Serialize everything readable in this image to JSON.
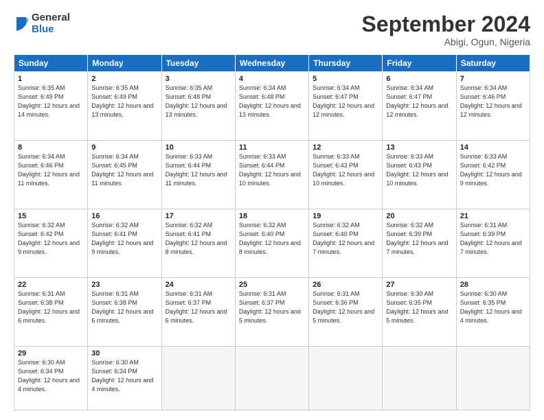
{
  "logo": {
    "general": "General",
    "blue": "Blue"
  },
  "header": {
    "month": "September 2024",
    "location": "Abigi, Ogun, Nigeria"
  },
  "weekdays": [
    "Sunday",
    "Monday",
    "Tuesday",
    "Wednesday",
    "Thursday",
    "Friday",
    "Saturday"
  ],
  "weeks": [
    [
      {
        "day": "1",
        "sunrise": "Sunrise: 6:35 AM",
        "sunset": "Sunset: 6:49 PM",
        "daylight": "Daylight: 12 hours and 14 minutes."
      },
      {
        "day": "2",
        "sunrise": "Sunrise: 6:35 AM",
        "sunset": "Sunset: 6:49 PM",
        "daylight": "Daylight: 12 hours and 13 minutes."
      },
      {
        "day": "3",
        "sunrise": "Sunrise: 6:35 AM",
        "sunset": "Sunset: 6:48 PM",
        "daylight": "Daylight: 12 hours and 13 minutes."
      },
      {
        "day": "4",
        "sunrise": "Sunrise: 6:34 AM",
        "sunset": "Sunset: 6:48 PM",
        "daylight": "Daylight: 12 hours and 13 minutes."
      },
      {
        "day": "5",
        "sunrise": "Sunrise: 6:34 AM",
        "sunset": "Sunset: 6:47 PM",
        "daylight": "Daylight: 12 hours and 12 minutes."
      },
      {
        "day": "6",
        "sunrise": "Sunrise: 6:34 AM",
        "sunset": "Sunset: 6:47 PM",
        "daylight": "Daylight: 12 hours and 12 minutes."
      },
      {
        "day": "7",
        "sunrise": "Sunrise: 6:34 AM",
        "sunset": "Sunset: 6:46 PM",
        "daylight": "Daylight: 12 hours and 12 minutes."
      }
    ],
    [
      {
        "day": "8",
        "sunrise": "Sunrise: 6:34 AM",
        "sunset": "Sunset: 6:46 PM",
        "daylight": "Daylight: 12 hours and 11 minutes."
      },
      {
        "day": "9",
        "sunrise": "Sunrise: 6:34 AM",
        "sunset": "Sunset: 6:45 PM",
        "daylight": "Daylight: 12 hours and 11 minutes."
      },
      {
        "day": "10",
        "sunrise": "Sunrise: 6:33 AM",
        "sunset": "Sunset: 6:44 PM",
        "daylight": "Daylight: 12 hours and 11 minutes."
      },
      {
        "day": "11",
        "sunrise": "Sunrise: 6:33 AM",
        "sunset": "Sunset: 6:44 PM",
        "daylight": "Daylight: 12 hours and 10 minutes."
      },
      {
        "day": "12",
        "sunrise": "Sunrise: 6:33 AM",
        "sunset": "Sunset: 6:43 PM",
        "daylight": "Daylight: 12 hours and 10 minutes."
      },
      {
        "day": "13",
        "sunrise": "Sunrise: 6:33 AM",
        "sunset": "Sunset: 6:43 PM",
        "daylight": "Daylight: 12 hours and 10 minutes."
      },
      {
        "day": "14",
        "sunrise": "Sunrise: 6:33 AM",
        "sunset": "Sunset: 6:42 PM",
        "daylight": "Daylight: 12 hours and 9 minutes."
      }
    ],
    [
      {
        "day": "15",
        "sunrise": "Sunrise: 6:32 AM",
        "sunset": "Sunset: 6:42 PM",
        "daylight": "Daylight: 12 hours and 9 minutes."
      },
      {
        "day": "16",
        "sunrise": "Sunrise: 6:32 AM",
        "sunset": "Sunset: 6:41 PM",
        "daylight": "Daylight: 12 hours and 9 minutes."
      },
      {
        "day": "17",
        "sunrise": "Sunrise: 6:32 AM",
        "sunset": "Sunset: 6:41 PM",
        "daylight": "Daylight: 12 hours and 8 minutes."
      },
      {
        "day": "18",
        "sunrise": "Sunrise: 6:32 AM",
        "sunset": "Sunset: 6:40 PM",
        "daylight": "Daylight: 12 hours and 8 minutes."
      },
      {
        "day": "19",
        "sunrise": "Sunrise: 6:32 AM",
        "sunset": "Sunset: 6:40 PM",
        "daylight": "Daylight: 12 hours and 7 minutes."
      },
      {
        "day": "20",
        "sunrise": "Sunrise: 6:32 AM",
        "sunset": "Sunset: 6:39 PM",
        "daylight": "Daylight: 12 hours and 7 minutes."
      },
      {
        "day": "21",
        "sunrise": "Sunrise: 6:31 AM",
        "sunset": "Sunset: 6:39 PM",
        "daylight": "Daylight: 12 hours and 7 minutes."
      }
    ],
    [
      {
        "day": "22",
        "sunrise": "Sunrise: 6:31 AM",
        "sunset": "Sunset: 6:38 PM",
        "daylight": "Daylight: 12 hours and 6 minutes."
      },
      {
        "day": "23",
        "sunrise": "Sunrise: 6:31 AM",
        "sunset": "Sunset: 6:38 PM",
        "daylight": "Daylight: 12 hours and 6 minutes."
      },
      {
        "day": "24",
        "sunrise": "Sunrise: 6:31 AM",
        "sunset": "Sunset: 6:37 PM",
        "daylight": "Daylight: 12 hours and 6 minutes."
      },
      {
        "day": "25",
        "sunrise": "Sunrise: 6:31 AM",
        "sunset": "Sunset: 6:37 PM",
        "daylight": "Daylight: 12 hours and 5 minutes."
      },
      {
        "day": "26",
        "sunrise": "Sunrise: 6:31 AM",
        "sunset": "Sunset: 6:36 PM",
        "daylight": "Daylight: 12 hours and 5 minutes."
      },
      {
        "day": "27",
        "sunrise": "Sunrise: 6:30 AM",
        "sunset": "Sunset: 6:35 PM",
        "daylight": "Daylight: 12 hours and 5 minutes."
      },
      {
        "day": "28",
        "sunrise": "Sunrise: 6:30 AM",
        "sunset": "Sunset: 6:35 PM",
        "daylight": "Daylight: 12 hours and 4 minutes."
      }
    ],
    [
      {
        "day": "29",
        "sunrise": "Sunrise: 6:30 AM",
        "sunset": "Sunset: 6:34 PM",
        "daylight": "Daylight: 12 hours and 4 minutes."
      },
      {
        "day": "30",
        "sunrise": "Sunrise: 6:30 AM",
        "sunset": "Sunset: 6:34 PM",
        "daylight": "Daylight: 12 hours and 4 minutes."
      },
      null,
      null,
      null,
      null,
      null
    ]
  ]
}
